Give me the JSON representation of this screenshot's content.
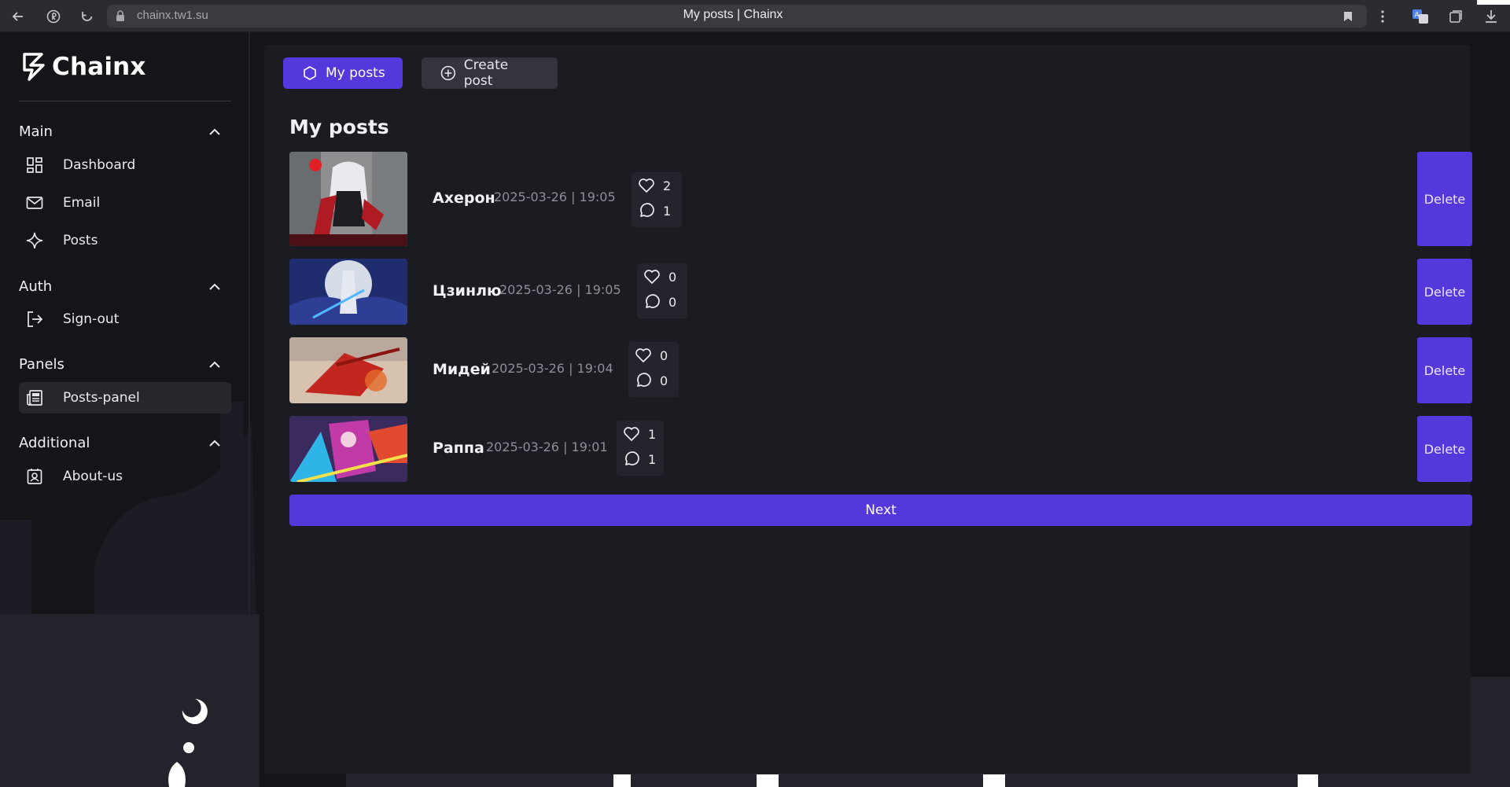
{
  "browser": {
    "url": "chainx.tw1.su",
    "title": "My posts | Chainx"
  },
  "brand": {
    "name": "Chainx"
  },
  "sidebar": {
    "sections": [
      {
        "label": "Main",
        "items": [
          {
            "label": "Dashboard",
            "icon": "dashboard-icon"
          },
          {
            "label": "Email",
            "icon": "mail-icon"
          },
          {
            "label": "Posts",
            "icon": "sparkle-icon"
          }
        ]
      },
      {
        "label": "Auth",
        "items": [
          {
            "label": "Sign-out",
            "icon": "sign-out-icon"
          }
        ]
      },
      {
        "label": "Panels",
        "items": [
          {
            "label": "Posts-panel",
            "icon": "newspaper-icon",
            "active": true
          }
        ]
      },
      {
        "label": "Additional",
        "items": [
          {
            "label": "About-us",
            "icon": "contact-card-icon"
          }
        ]
      }
    ]
  },
  "tabs": {
    "my_posts": "My posts",
    "create_post": "Create post"
  },
  "page": {
    "heading": "My posts"
  },
  "posts": [
    {
      "title": "Ахерон",
      "date": "2025-03-26 | 19:05",
      "likes": "2",
      "comments": "1"
    },
    {
      "title": "Цзинлю",
      "date": "2025-03-26 | 19:05",
      "likes": "0",
      "comments": "0"
    },
    {
      "title": "Мидей",
      "date": "2025-03-26 | 19:04",
      "likes": "0",
      "comments": "0"
    },
    {
      "title": "Раппа",
      "date": "2025-03-26 | 19:01",
      "likes": "1",
      "comments": "1"
    }
  ],
  "actions": {
    "delete_label": "Delete",
    "next_label": "Next"
  },
  "colors": {
    "accent": "#5438dc",
    "background": "#141419",
    "panel": "#1b1b22"
  }
}
